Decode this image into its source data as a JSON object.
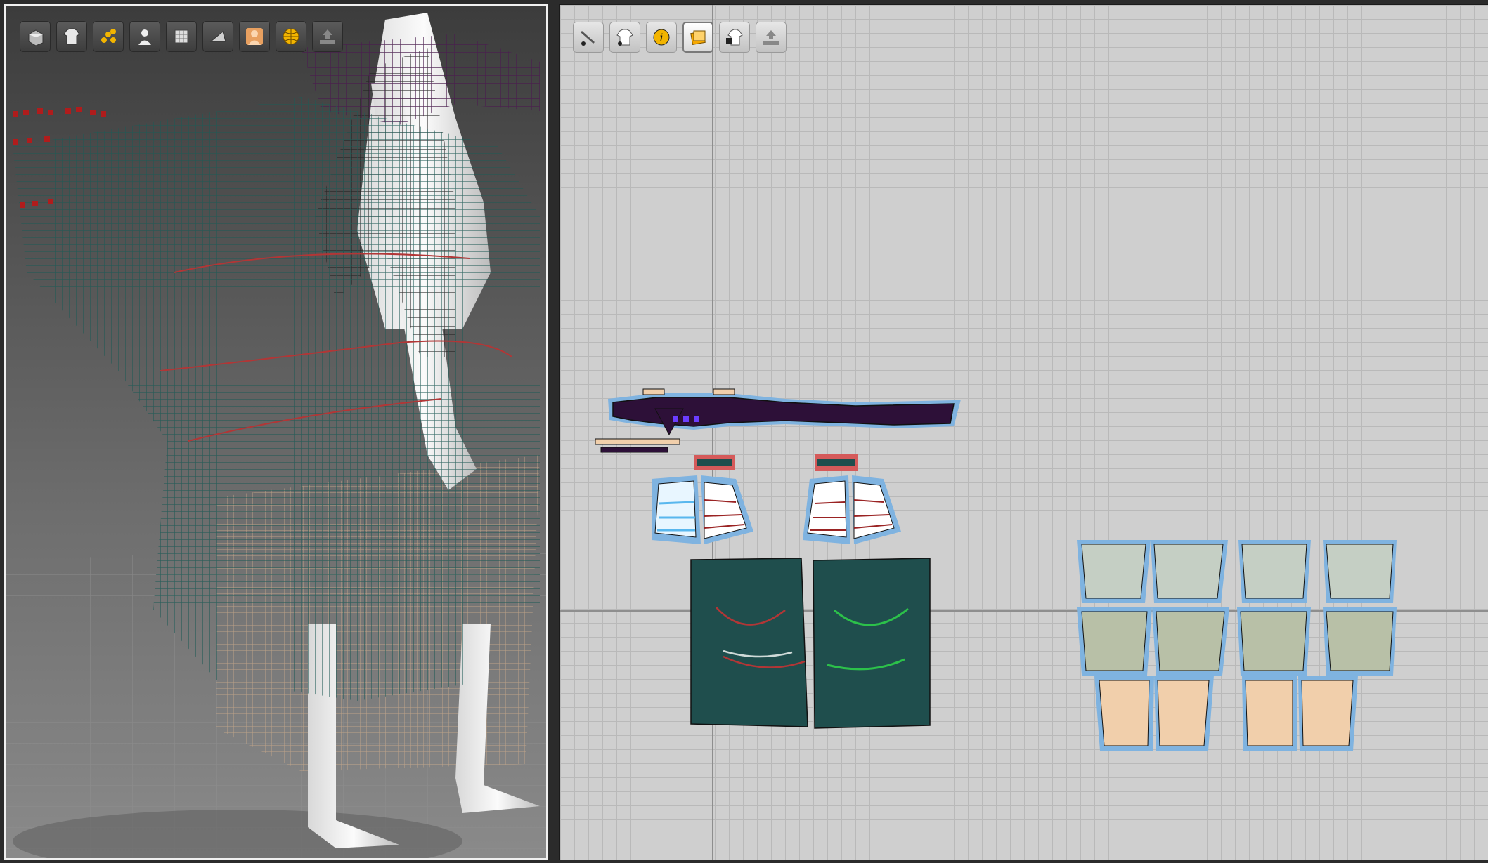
{
  "window": {
    "panes": [
      "3d-garment-window",
      "2d-pattern-window"
    ]
  },
  "toolbar_3d": {
    "buttons": [
      {
        "icon": "box-view-icon",
        "tooltip": ""
      },
      {
        "icon": "garment-display-icon",
        "tooltip": ""
      },
      {
        "icon": "particle-points-icon",
        "tooltip": ""
      },
      {
        "icon": "avatar-display-icon",
        "tooltip": ""
      },
      {
        "icon": "texture-icon",
        "tooltip": ""
      },
      {
        "icon": "flatten-icon",
        "tooltip": ""
      },
      {
        "icon": "avatar-skin-icon",
        "tooltip": ""
      },
      {
        "icon": "globe-icon",
        "tooltip": ""
      },
      {
        "icon": "hanger-upload-icon",
        "tooltip": ""
      }
    ]
  },
  "toolbar_2d": {
    "buttons": [
      {
        "icon": "pattern-pen-icon",
        "active": false
      },
      {
        "icon": "garment-view-icon",
        "active": false
      },
      {
        "icon": "info-icon",
        "active": false
      },
      {
        "icon": "layer-sheet-icon",
        "active": true
      },
      {
        "icon": "garment-lock-icon",
        "active": false
      },
      {
        "icon": "hanger-upload-icon",
        "active": false
      }
    ]
  },
  "colors": {
    "bg_2d": "#cfcfcf",
    "pattern_outline": "#7fb3e0",
    "pattern_purple": "#2d1038",
    "pattern_teal": "#1f4e4d",
    "pattern_green_grey": "#b8c0a7",
    "pattern_light_grey": "#c5cfc4",
    "pattern_peach": "#f1cfab",
    "seam_red": "#b23636",
    "seam_green": "#2cc14a",
    "mesh_teal": "#1e5a55",
    "mesh_dark": "#222"
  }
}
